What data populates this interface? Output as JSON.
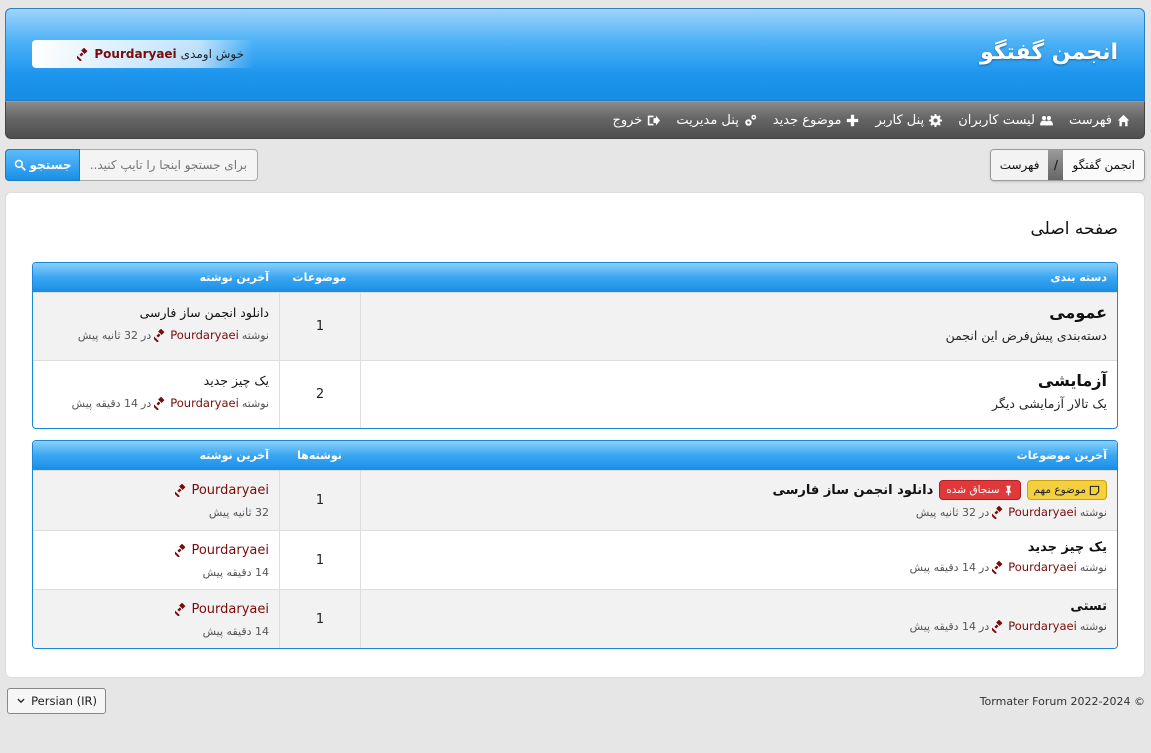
{
  "header": {
    "site_title": "انجمن گفتگو",
    "welcome_text": "خوش اومدی",
    "username": "Pourdaryaei"
  },
  "nav": {
    "items": [
      {
        "label": "فهرست",
        "icon": "home-icon"
      },
      {
        "label": "لیست کاربران",
        "icon": "users-icon"
      },
      {
        "label": "پنل کاربر",
        "icon": "gear-icon"
      },
      {
        "label": "موضوع جدید",
        "icon": "plus-icon"
      },
      {
        "label": "پنل مدیریت",
        "icon": "gears-icon"
      },
      {
        "label": "خروج",
        "icon": "sign-out-icon"
      }
    ]
  },
  "breadcrumb": {
    "items": [
      "انجمن گفتگو",
      "فهرست"
    ],
    "separator": "/"
  },
  "search": {
    "button_label": "جستجو",
    "placeholder": "برای جستجو اینجا را تایپ کنید..."
  },
  "page_title": "صفحه اصلی",
  "categories_table": {
    "headers": [
      "دسته بندی",
      "موضوعات",
      "آخرین نوشته"
    ],
    "rows": [
      {
        "title": "عمومی",
        "description": "دسته‌بندی پیش‌فرض این انجمن",
        "topics": "1",
        "last_title": "دانلود انجمن ساز فارسی",
        "by": "نوشته",
        "user": "Pourdaryaei",
        "in": "در",
        "time": "32 ثانیه پیش"
      },
      {
        "title": "آزمایشی",
        "description": "یک تالار آزمایشی دیگر",
        "topics": "2",
        "last_title": "یک چیز جدید",
        "by": "نوشته",
        "user": "Pourdaryaei",
        "in": "در",
        "time": "14 دقیقه پیش"
      }
    ]
  },
  "topics_table": {
    "headers": [
      "آخرین موضوعات",
      "نوشته‌ها",
      "آخرین نوشته"
    ],
    "rows": [
      {
        "badges": [
          "موضوع مهم",
          "سنجاق شده"
        ],
        "title": "دانلود انجمن ساز فارسی",
        "by": "نوشته",
        "user": "Pourdaryaei",
        "in": "در",
        "time": "32 ثانیه پیش",
        "posts": "1",
        "last_user": "Pourdaryaei",
        "last_time": "32 ثانیه پیش"
      },
      {
        "badges": [],
        "title": "یک چیز جدید",
        "by": "نوشته",
        "user": "Pourdaryaei",
        "in": "در",
        "time": "14 دقیقه پیش",
        "posts": "1",
        "last_user": "Pourdaryaei",
        "last_time": "14 دقیقه پیش"
      },
      {
        "badges": [],
        "title": "تستی",
        "by": "نوشته",
        "user": "Pourdaryaei",
        "in": "در",
        "time": "14 دقیقه پیش",
        "posts": "1",
        "last_user": "Pourdaryaei",
        "last_time": "14 دقیقه پیش"
      }
    ]
  },
  "footer": {
    "copyright": "Tormater Forum 2022-2024 ©",
    "language": "Persian (IR)"
  },
  "colors": {
    "accent_blue": "#1a8fe6",
    "username_red": "#7a0b0b",
    "badge_yellow": "#f4d03f",
    "badge_red": "#e0393b"
  }
}
